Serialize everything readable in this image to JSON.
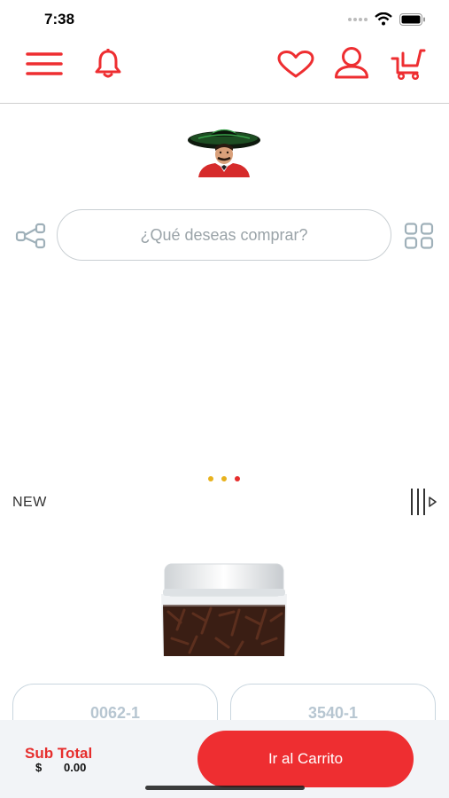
{
  "status_bar": {
    "time": "7:38"
  },
  "header": {
    "menu_icon": "hamburger-menu-icon",
    "bell_icon": "bell-icon",
    "heart_icon": "heart-icon",
    "user_icon": "user-icon",
    "cart_icon": "shopping-cart-icon"
  },
  "search": {
    "placeholder": "¿Qué deseas comprar?"
  },
  "carousel": {
    "dot_colors": [
      "#e8b21e",
      "#e8b21e",
      "#e62e2d"
    ]
  },
  "section": {
    "label": "NEW"
  },
  "products": [
    {
      "code": "0062-1"
    },
    {
      "code": "3540-1"
    }
  ],
  "footer": {
    "subtotal_label": "Sub Total",
    "currency": "$",
    "subtotal_value": "0.00",
    "cart_button_label": "Ir al Carrito"
  },
  "colors": {
    "accent": "#ee2e31",
    "icon_gray": "#9fb0b9"
  }
}
